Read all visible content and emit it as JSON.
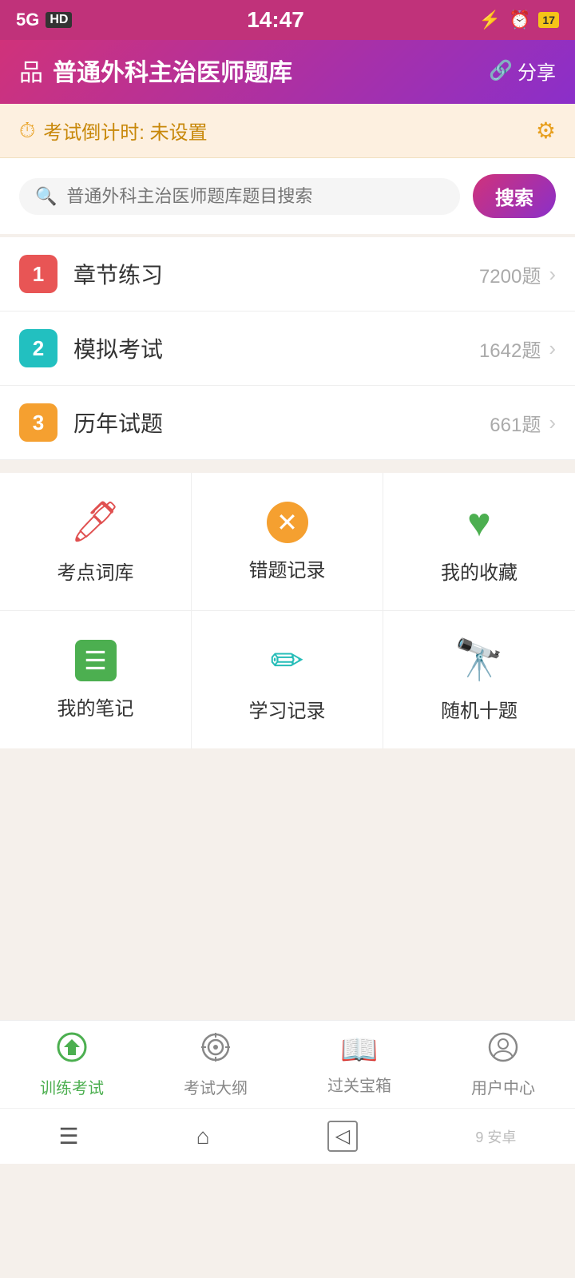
{
  "statusBar": {
    "signal": "5G",
    "hd": "HD",
    "time": "14:47",
    "battery": "17"
  },
  "header": {
    "icon": "品",
    "title": "普通外科主治医师题库",
    "shareLabel": "分享"
  },
  "countdown": {
    "label": "考试倒计时: 未设置"
  },
  "search": {
    "placeholder": "普通外科主治医师题库题目搜索",
    "buttonLabel": "搜索"
  },
  "menuItems": [
    {
      "num": "1",
      "numClass": "num-red",
      "label": "章节练习",
      "count": "7200题"
    },
    {
      "num": "2",
      "numClass": "num-cyan",
      "label": "模拟考试",
      "count": "1642题"
    },
    {
      "num": "3",
      "numClass": "num-orange",
      "label": "历年试题",
      "count": "661题"
    }
  ],
  "gridItems": [
    {
      "iconType": "pencil-red",
      "label": "考点词库"
    },
    {
      "iconType": "x-orange",
      "label": "错题记录"
    },
    {
      "iconType": "heart-green",
      "label": "我的收藏"
    },
    {
      "iconType": "list-green",
      "label": "我的笔记"
    },
    {
      "iconType": "pen-teal",
      "label": "学习记录"
    },
    {
      "iconType": "binoculars-yellow",
      "label": "随机十题"
    }
  ],
  "bottomNav": [
    {
      "id": "train",
      "label": "训练考试",
      "active": true
    },
    {
      "id": "outline",
      "label": "考试大纲",
      "active": false
    },
    {
      "id": "treasure",
      "label": "过关宝箱",
      "active": false
    },
    {
      "id": "user",
      "label": "用户中心",
      "active": false
    }
  ],
  "sysNav": {
    "menu": "☰",
    "home": "⌂",
    "back": "◁"
  }
}
